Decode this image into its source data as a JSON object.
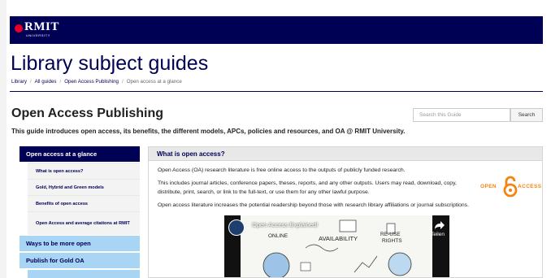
{
  "brand": {
    "logo_name": "RMIT",
    "logo_sub": "UNIVERSITY",
    "accent": "#000054",
    "logo_dot": "#e60028",
    "nav_light": "#a9d5f5",
    "oa_orange": "#f68212"
  },
  "site_title": "Library subject guides",
  "breadcrumb": {
    "items": [
      "Library",
      "All guides",
      "Open Access Publishing"
    ],
    "current": "Open access at a glance",
    "separator": "/"
  },
  "guide": {
    "title": "Open Access Publishing",
    "description": "This guide introduces open access, its benefits, the different models, APCs, policies and resources, and OA @ RMIT University."
  },
  "search": {
    "placeholder": "Search this Guide",
    "button": "Search"
  },
  "nav": {
    "active": "Open access at a glance",
    "sub_items": [
      "What is open access?",
      "Gold, Hybrid and Green models",
      "Benefits of open access",
      "Open Access and average citations at RMIT"
    ],
    "sections": [
      "Ways to be more open",
      "Publish for Gold OA"
    ]
  },
  "panel": {
    "heading": "What is open access?",
    "para1": "Open Access (OA) research literature is free online access to the outputs of publicly funded research.",
    "para2": "This includes journal articles, conference papers, theses, reports, and any other outputs. Users may read, download, copy, distribute, print, search, or link to the full-text, or use them for any other lawful purpose.",
    "para3": "Open access literature increases the potential readership beyond those with research library affiliations or journal subscriptions.",
    "oa_logo_left": "OPEN",
    "oa_logo_right": "ACCESS"
  },
  "video": {
    "title": "Open Access Explained!",
    "share_label": "Teilen",
    "share_icon": "share-arrow-icon",
    "doodle_words": [
      "ONLINE",
      "AVAILABILITY",
      "RE-USE",
      "RIGHTS"
    ]
  }
}
